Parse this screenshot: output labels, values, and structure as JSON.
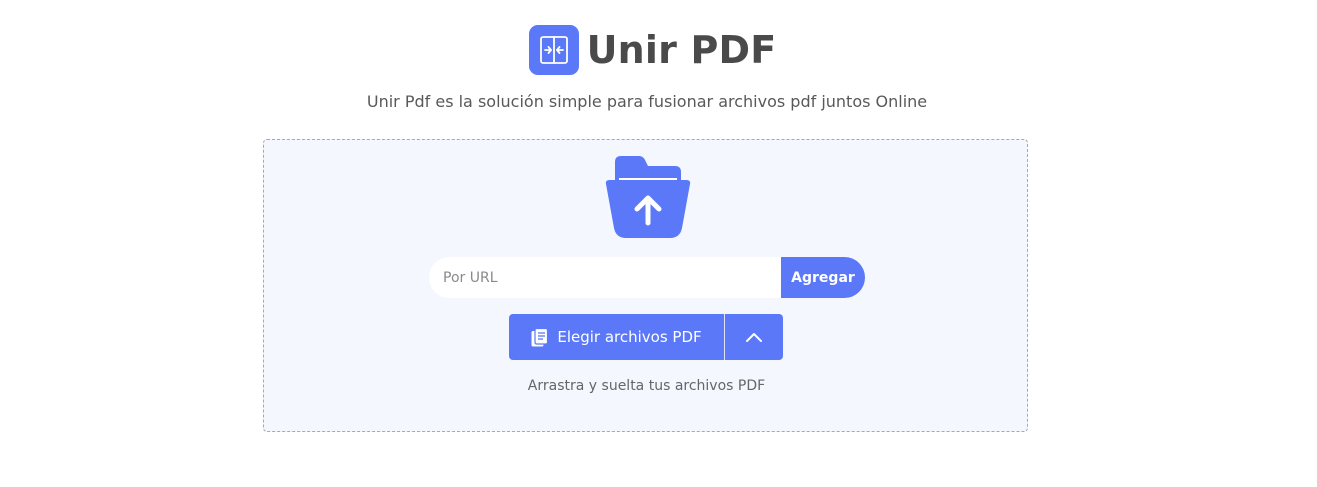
{
  "header": {
    "title": "Unir PDF",
    "subtitle": "Unir Pdf es la solución simple para fusionar archivos pdf juntos Online",
    "logo_icon": "merge-pdf-icon"
  },
  "dropzone": {
    "upload_icon": "folder-upload-icon",
    "url_input": {
      "placeholder": "Por URL",
      "value": ""
    },
    "add_button_label": "Agregar",
    "choose_button_label": "Elegir archivos PDF",
    "choose_button_icon": "documents-icon",
    "toggle_icon": "chevron-up-icon",
    "hint": "Arrastra y suelta tus archivos PDF"
  },
  "colors": {
    "accent": "#5a78f7",
    "dropzone_bg": "#f4f7fe",
    "text": "#4a4a4a"
  }
}
